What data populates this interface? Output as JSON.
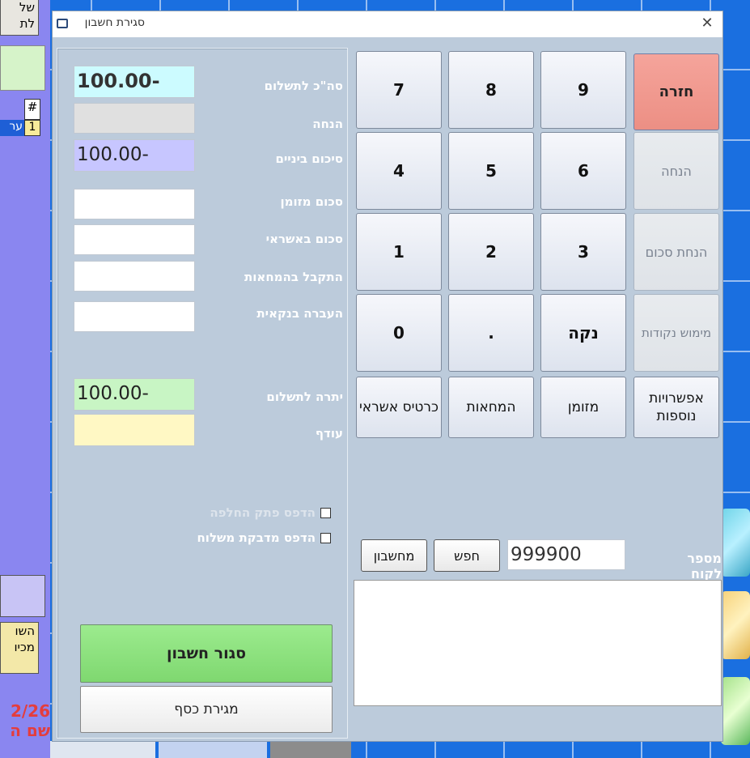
{
  "background": {
    "top_button_lines": "של\nלת",
    "table_header": "#",
    "table_row_num": "1",
    "table_row_text": "ער",
    "bottom_button_lines": "השו\nמכיו",
    "date_fragment": "2/26",
    "red_text_fragment": "שם ה"
  },
  "dialog": {
    "title": "סגירת חשבון",
    "close_glyph": "✕"
  },
  "fields": {
    "total_label": "סה\"כ לתשלום",
    "total_value": "100.00-",
    "discount_label": "הנחה",
    "discount_value": "",
    "subtotal_label": "סיכום ביניים",
    "subtotal_value": "100.00-",
    "cash_label": "סכום מזומן",
    "cash_value": "",
    "credit_label": "סכום באשראי",
    "credit_value": "",
    "cheques_label": "התקבל בהמחאות",
    "cheques_value": "",
    "transfer_label": " העברה בנקאית",
    "transfer_value": "",
    "balance_label": "יתרה לתשלום",
    "balance_value": "100.00-",
    "change_label": "עודף",
    "change_value": ""
  },
  "checkboxes": {
    "print_exchange": "הדפס פתק החלפה",
    "print_shipping": "הדפס מדבקת משלוח"
  },
  "buttons": {
    "close_account": "סגור חשבון",
    "cash_drawer": "מגירת כסף"
  },
  "keypad": {
    "k7": "7",
    "k8": "8",
    "k9": "9",
    "k4": "4",
    "k5": "5",
    "k6": "6",
    "k1": "1",
    "k2": "2",
    "k3": "3",
    "k0": "0",
    "kdot": ".",
    "clear": "נקה",
    "back": "חזרה",
    "discount": "הנחה",
    "amount_discount": "הנחת סכום",
    "redeem_points": "מימוש נקודות",
    "credit_card": "כרטיס אשראי",
    "cheques": "המחאות",
    "cash": "מזומן",
    "more_options": "אפשרויות נוספות"
  },
  "customer": {
    "label": "מספר לקוח",
    "value": "999900",
    "search_button": "חפש",
    "account_button": "מחשבון"
  },
  "colors": {
    "dialog_bg": "#bccbdb",
    "total_box": "#ccfbff",
    "discount_box": "#e0e0e0",
    "subtotal_box": "#c7c6ff",
    "balance_box": "#c8f5c4",
    "change_box": "#fff8c4",
    "back_button": "#f2988e",
    "close_account_button": "#8fe37f"
  }
}
